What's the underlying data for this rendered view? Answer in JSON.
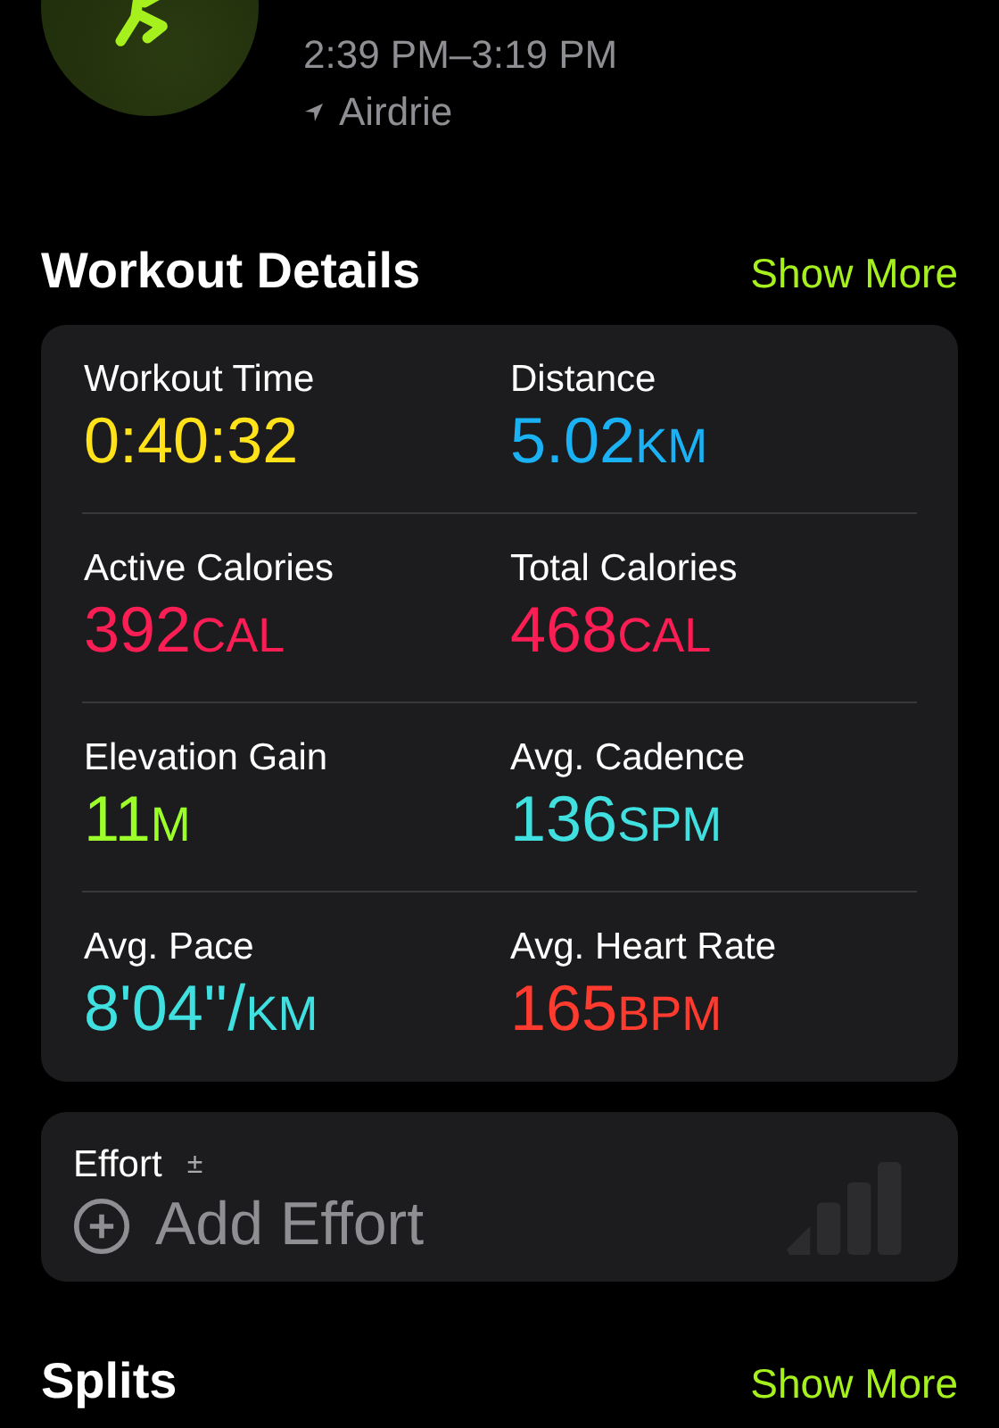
{
  "workout": {
    "time_range": "2:39 PM–3:19 PM",
    "location": "Airdrie"
  },
  "workout_details": {
    "title": "Workout Details",
    "action": "Show More",
    "metrics": [
      {
        "label": "Workout Time",
        "value": "0:40:32",
        "color": "#ffe21a"
      },
      {
        "label": "Distance",
        "value": "5.02",
        "unit": "KM",
        "color": "#1ab2f5"
      },
      {
        "label": "Active Calories",
        "value": "392",
        "unit": "CAL",
        "color": "#fa1e55"
      },
      {
        "label": "Total Calories",
        "value": "468",
        "unit": "CAL",
        "color": "#fa1e55"
      },
      {
        "label": "Elevation Gain",
        "value": "11",
        "unit": "M",
        "color": "#9dff2a"
      },
      {
        "label": "Avg. Cadence",
        "value": "136",
        "unit": "SPM",
        "color": "#40e0e0"
      },
      {
        "label": "Avg. Pace",
        "value": "8'04''/",
        "unit": "KM",
        "color": "#40e0e0"
      },
      {
        "label": "Avg. Heart Rate",
        "value": "165",
        "unit": "BPM",
        "color": "#ff3b30"
      }
    ]
  },
  "effort": {
    "title": "Effort",
    "adjust_symbol": "±",
    "placeholder": "Add Effort"
  },
  "splits": {
    "title": "Splits",
    "action": "Show More"
  }
}
